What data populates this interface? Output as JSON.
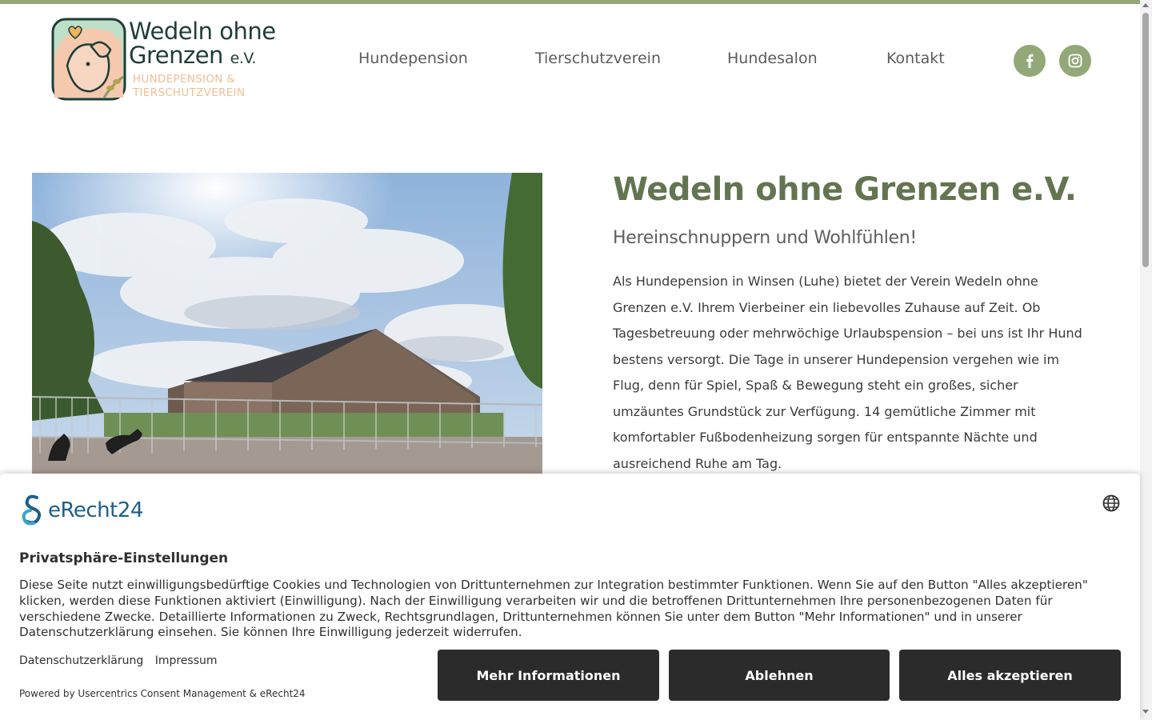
{
  "logo": {
    "title_line1": "Wedeln ohne",
    "title_line2": "Grenzen",
    "title_ev": "e.V.",
    "sub_line1": "HUNDEPENSION &",
    "sub_line2": "TIERSCHUTZVEREIN"
  },
  "nav": {
    "items": [
      {
        "label": "Hundepension"
      },
      {
        "label": "Tierschutzverein"
      },
      {
        "label": "Hundesalon"
      },
      {
        "label": "Kontakt"
      }
    ],
    "social": [
      {
        "icon": "facebook-icon"
      },
      {
        "icon": "instagram-icon"
      }
    ]
  },
  "main": {
    "heading": "Wedeln ohne Grenzen e.V.",
    "subheading": "Hereinschnuppern und Wohlfühlen!",
    "paragraph": "Als Hundepension in Winsen (Luhe) bietet der Verein Wedeln ohne Grenzen e.V. Ihrem Vierbeiner ein liebevolles Zuhause auf Zeit. Ob Tagesbetreuung oder mehrwöchige Urlaubspension – bei uns ist Ihr Hund bestens versorgt. Die Tage in unserer Hundepension vergehen wie im Flug, denn für Spiel, Spaß & Bewegung steht ein großes, sicher umzäuntes Grundstück zur Verfügung. 14 gemütliche Zimmer mit komfortabler Fußbodenheizung sorgen für entspannte Nächte und ausreichend Ruhe am Tag."
  },
  "consent": {
    "brand": "eRecht24",
    "title": "Privatsphäre-Einstellungen",
    "text": "Diese Seite nutzt einwilligungsbedürftige Cookies und Technologien von Drittunternehmen zur Integration bestimmter Funktionen. Wenn Sie auf den Button \"Alles akzeptieren\" klicken, werden diese Funktionen aktiviert (Einwilligung). Nach der Einwilligung verarbeiten wir und die betroffenen Drittunternehmen Ihre personenbezogenen Daten für verschiedene Zwecke. Detaillierte Informationen zu Zweck, Rechtsgrundlagen, Drittunternehmen können Sie unter dem Button \"Mehr Informationen\" und in unserer Datenschutzerklärung einsehen. Sie können Ihre Einwilligung jederzeit widerrufen.",
    "link_privacy": "Datenschutzerklärung",
    "link_imprint": "Impressum",
    "powered": "Powered by Usercentrics Consent Management & eRecht24",
    "btn_more": "Mehr Informationen",
    "btn_decline": "Ablehnen",
    "btn_accept": "Alles akzeptieren"
  },
  "colors": {
    "accent": "#93a879",
    "heading": "#637550",
    "button": "#2b2b2b",
    "brand_blue": "#1d5f8a"
  }
}
